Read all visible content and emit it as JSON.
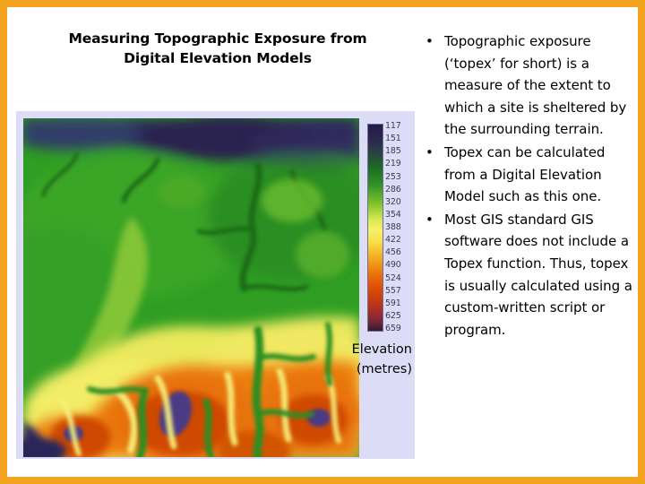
{
  "slide": {
    "border_color": "#f2a21c",
    "background_color": "#ffffff"
  },
  "title": {
    "line1": "Measuring Topographic Exposure from",
    "line2": "Digital Elevation Models"
  },
  "figure": {
    "panel_background_color": "#dcdcf7",
    "dem_alt": "digital-elevation-model-raster",
    "legend": {
      "caption_line1": "Elevation",
      "caption_line2": "(metres)",
      "colorbar_low_color": "#241a4a",
      "colorbar_high_color": "#3a1830",
      "ticks": [
        "117",
        "151",
        "185",
        "219",
        "253",
        "286",
        "320",
        "354",
        "388",
        "422",
        "456",
        "490",
        "524",
        "557",
        "591",
        "625",
        "659"
      ]
    }
  },
  "bullets": {
    "marker": "•",
    "items": [
      {
        "text": "Topographic exposure (‘topex’ for short) is a measure of the extent to which a site is sheltered by the surrounding terrain."
      },
      {
        "text": "Topex can be calculated from a Digital Elevation Model such as this one."
      },
      {
        "text": "Most GIS standard GIS software does not include a Topex function. Thus, topex is usually calculated using a custom-written script or program."
      }
    ]
  }
}
